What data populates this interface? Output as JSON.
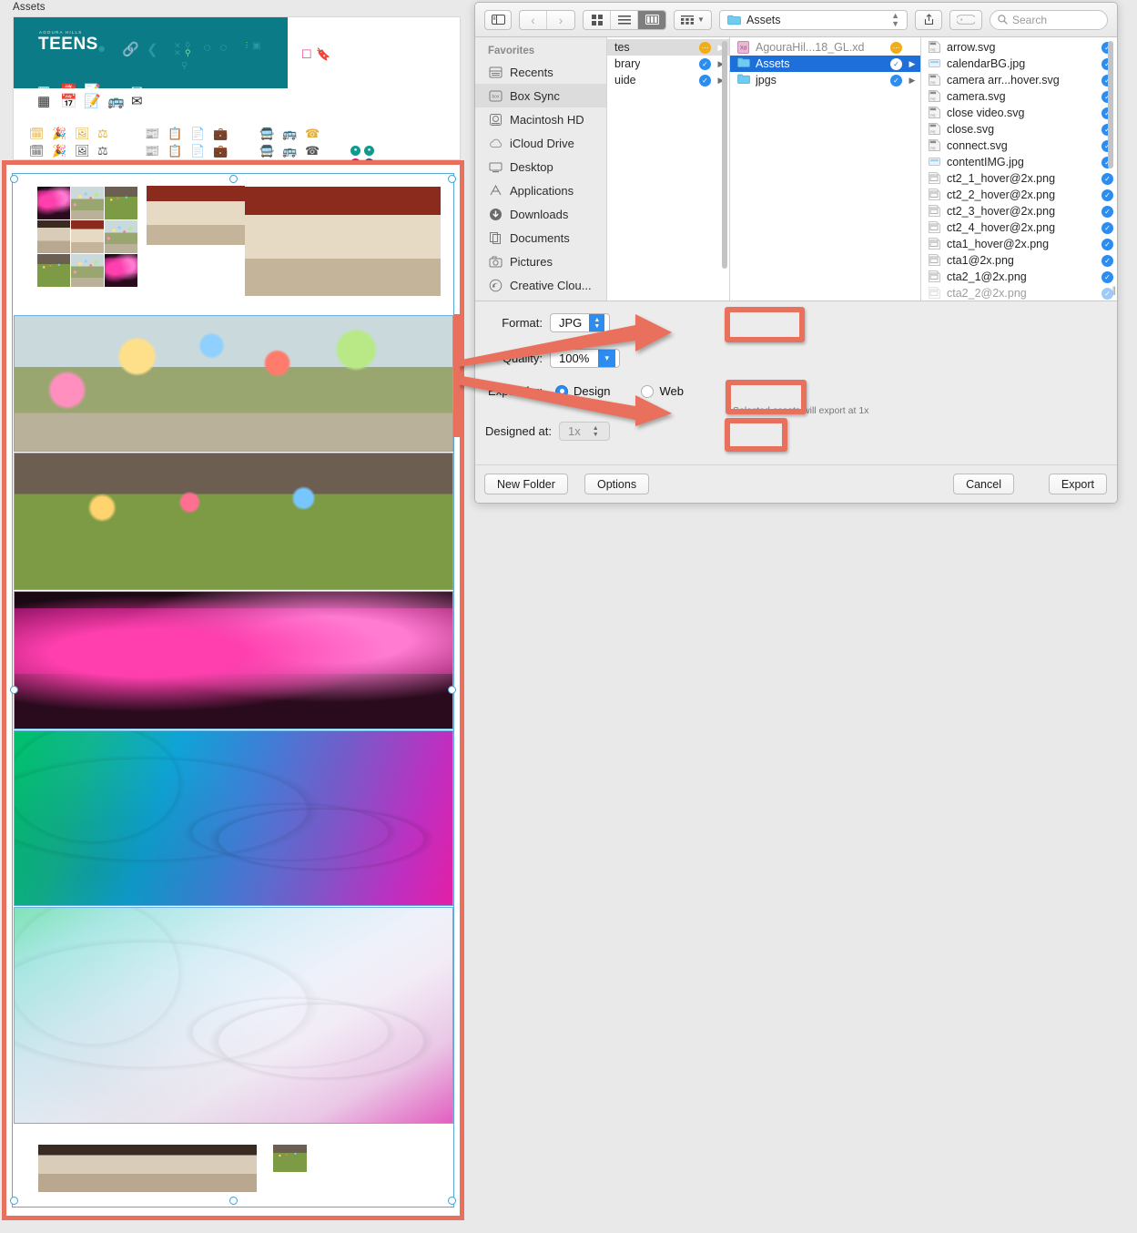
{
  "xd": {
    "panel_title": "Assets",
    "brand": {
      "kicker": "AGOURA HILLS",
      "name": "TEENS",
      "teal": "#0b7c87"
    },
    "selection_color": "#e8705c",
    "artboard_images": [
      {
        "name": "photo-mosaic-thumbnails"
      },
      {
        "name": "photo-lounge-small"
      },
      {
        "name": "photo-lounge-large"
      },
      {
        "name": "photo-teens-balloons"
      },
      {
        "name": "photo-teens-lawn"
      },
      {
        "name": "photo-dance-party"
      },
      {
        "name": "gradient-vivid-swirl"
      },
      {
        "name": "gradient-soft-swirl"
      },
      {
        "name": "photo-pingpong"
      },
      {
        "name": "photo-group-small"
      }
    ]
  },
  "finder": {
    "toolbar": {
      "sidebar_toggle": "sidebar-toggle",
      "back": "‹",
      "forward": "›",
      "view_icon": "icon-view",
      "view_list": "list-view",
      "view_column": "column-view",
      "group_label": "group-by",
      "path_label": "Assets",
      "share_label": "share",
      "tag_label": "tag",
      "search_placeholder": "Search"
    },
    "sidebar": {
      "heading": "Favorites",
      "items": [
        {
          "label": "Recents",
          "icon": "recents-icon",
          "selected": false
        },
        {
          "label": "Box Sync",
          "icon": "box-icon",
          "selected": true
        },
        {
          "label": "Macintosh HD",
          "icon": "harddisk-icon",
          "selected": false
        },
        {
          "label": "iCloud Drive",
          "icon": "cloud-icon",
          "selected": false
        },
        {
          "label": "Desktop",
          "icon": "desktop-icon",
          "selected": false
        },
        {
          "label": "Applications",
          "icon": "appstore-icon",
          "selected": false
        },
        {
          "label": "Downloads",
          "icon": "download-icon",
          "selected": false
        },
        {
          "label": "Documents",
          "icon": "documents-icon",
          "selected": false
        },
        {
          "label": "Pictures",
          "icon": "pictures-icon",
          "selected": false
        },
        {
          "label": "Creative Clou...",
          "icon": "creativecloud-icon",
          "selected": false
        }
      ]
    },
    "column1": [
      {
        "label": "tes",
        "badge": "amber",
        "arrow": true,
        "selected": true
      },
      {
        "label": "brary",
        "badge": "blue",
        "arrow": true,
        "selected": false
      },
      {
        "label": "uide",
        "badge": "blue",
        "arrow": true,
        "selected": false
      }
    ],
    "column2": [
      {
        "label": "AgouraHil...18_GL.xd",
        "icon": "xd-file-icon",
        "badge": "amber",
        "arrow": false,
        "selected": false,
        "dim": true
      },
      {
        "label": "Assets",
        "icon": "folder-icon",
        "badge": "blue",
        "arrow": true,
        "selected": true,
        "dim": false
      },
      {
        "label": "jpgs",
        "icon": "folder-icon",
        "badge": "blue",
        "arrow": true,
        "selected": false,
        "dim": false
      }
    ],
    "column3": [
      {
        "label": "arrow.svg",
        "icon": "svg-file-icon",
        "badge": "blue"
      },
      {
        "label": "calendarBG.jpg",
        "icon": "image-file-icon",
        "badge": "blue"
      },
      {
        "label": "camera arr...hover.svg",
        "icon": "svg-file-icon",
        "badge": "blue"
      },
      {
        "label": "camera.svg",
        "icon": "svg-file-icon",
        "badge": "blue"
      },
      {
        "label": "close video.svg",
        "icon": "svg-file-icon",
        "badge": "blue"
      },
      {
        "label": "close.svg",
        "icon": "svg-file-icon",
        "badge": "blue"
      },
      {
        "label": "connect.svg",
        "icon": "svg-file-icon",
        "badge": "blue"
      },
      {
        "label": "contentIMG.jpg",
        "icon": "image-file-icon",
        "badge": "blue"
      },
      {
        "label": "ct2_1_hover@2x.png",
        "icon": "png-file-icon",
        "badge": "blue"
      },
      {
        "label": "ct2_2_hover@2x.png",
        "icon": "png-file-icon",
        "badge": "blue"
      },
      {
        "label": "ct2_3_hover@2x.png",
        "icon": "png-file-icon",
        "badge": "blue"
      },
      {
        "label": "ct2_4_hover@2x.png",
        "icon": "png-file-icon",
        "badge": "blue"
      },
      {
        "label": "cta1_hover@2x.png",
        "icon": "png-file-icon",
        "badge": "blue"
      },
      {
        "label": "cta1@2x.png",
        "icon": "png-file-icon",
        "badge": "blue"
      },
      {
        "label": "cta2_1@2x.png",
        "icon": "png-file-icon",
        "badge": "blue"
      },
      {
        "label": "cta2_2@2x.png",
        "icon": "png-file-icon",
        "badge": "blue"
      }
    ]
  },
  "export": {
    "format_label": "Format:",
    "format_value": "JPG",
    "quality_label": "Quality:",
    "quality_value": "100%",
    "export_for_label": "Export for:",
    "design_label": "Design",
    "web_label": "Web",
    "design_selected": true,
    "hint": "Selected assets will export at 1x",
    "designed_at_label": "Designed at:",
    "designed_at_value": "1x",
    "new_folder_label": "New Folder",
    "options_label": "Options",
    "cancel_label": "Cancel",
    "export_label": "Export",
    "highlight_color": "#e8705c"
  }
}
